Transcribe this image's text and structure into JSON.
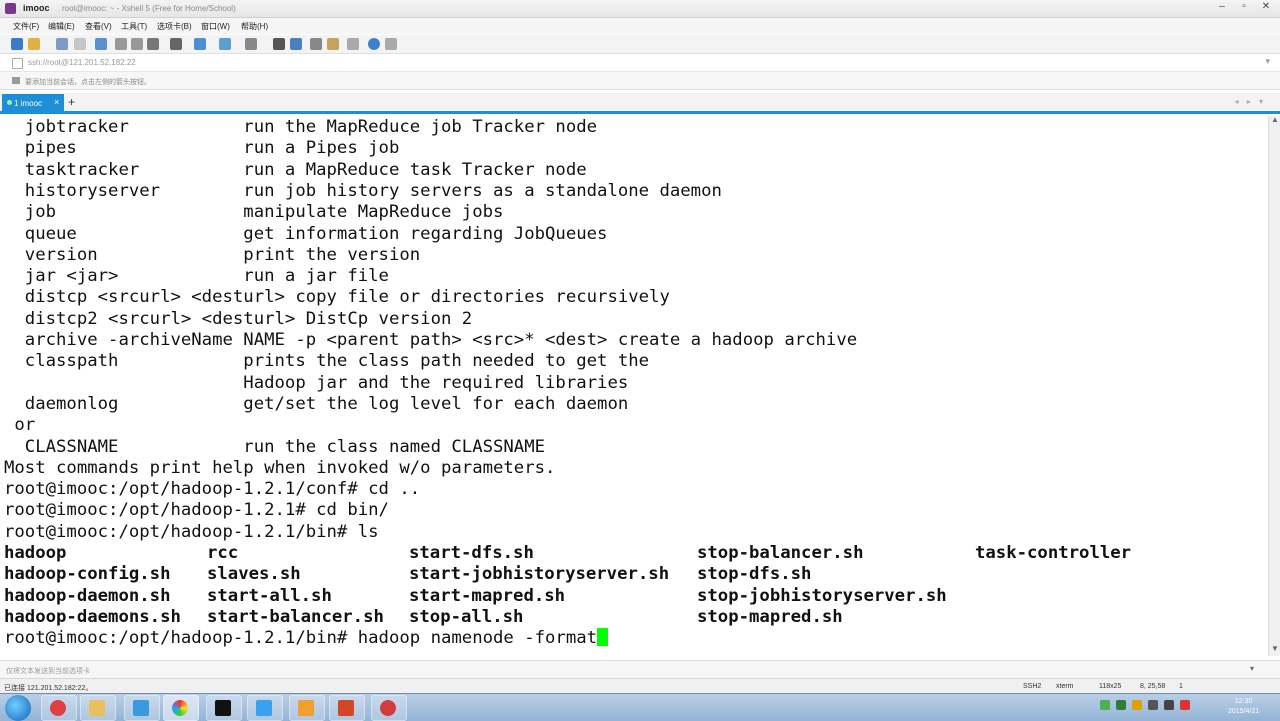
{
  "titlebar": {
    "tab": "imooc",
    "title": "root@imooc: ~ - Xshell 5 (Free for Home/School)"
  },
  "menu": [
    "文件(F)",
    "编辑(E)",
    "查看(V)",
    "工具(T)",
    "选项卡(B)",
    "窗口(W)",
    "帮助(H)"
  ],
  "address": {
    "value": "ssh://root@121.201.52.182:22"
  },
  "hint": {
    "text": "要添加当前会话，点击左侧的箭头按钮。"
  },
  "session_tab": {
    "label": "1 imooc",
    "close": "×",
    "add": "+",
    "nav": "◂ ▸ ▾"
  },
  "terminal": {
    "lines": [
      "  jobtracker           run the MapReduce job Tracker node",
      "  pipes                run a Pipes job",
      "  tasktracker          run a MapReduce task Tracker node",
      "  historyserver        run job history servers as a standalone daemon",
      "  job                  manipulate MapReduce jobs",
      "  queue                get information regarding JobQueues",
      "  version              print the version",
      "  jar <jar>            run a jar file",
      "  distcp <srcurl> <desturl> copy file or directories recursively",
      "  distcp2 <srcurl> <desturl> DistCp version 2",
      "  archive -archiveName NAME -p <parent path> <src>* <dest> create a hadoop archive",
      "  classpath            prints the class path needed to get the",
      "                       Hadoop jar and the required libraries",
      "  daemonlog            get/set the log level for each daemon",
      " or",
      "  CLASSNAME            run the class named CLASSNAME",
      "Most commands print help when invoked w/o parameters.",
      "root@imooc:/opt/hadoop-1.2.1/conf# cd ..",
      "root@imooc:/opt/hadoop-1.2.1# cd bin/",
      "root@imooc:/opt/hadoop-1.2.1/bin# ls"
    ],
    "ls_rows": [
      [
        "hadoop",
        "rcc",
        "start-dfs.sh",
        "stop-balancer.sh",
        "task-controller"
      ],
      [
        "hadoop-config.sh",
        "slaves.sh",
        "start-jobhistoryserver.sh",
        "stop-dfs.sh",
        ""
      ],
      [
        "hadoop-daemon.sh",
        "start-all.sh",
        "start-mapred.sh",
        "stop-jobhistoryserver.sh",
        ""
      ],
      [
        "hadoop-daemons.sh",
        "start-balancer.sh",
        "stop-all.sh",
        "stop-mapred.sh",
        ""
      ]
    ],
    "prompt": "root@imooc:/opt/hadoop-1.2.1/bin# hadoop namenode -format"
  },
  "compose": {
    "placeholder": "仅将文本发送到当前选项卡"
  },
  "status": {
    "connection": "已连接 121.201.52.182:22。",
    "protocol": "SSH2",
    "term": "xterm",
    "size": "118x25",
    "pos": "8, 25,58",
    "sessions": "1"
  },
  "clock": {
    "time": "12:30",
    "date": "2015/4/21"
  },
  "colors": {
    "accent": "#1e8fd6",
    "cursor": "#00ff00"
  }
}
